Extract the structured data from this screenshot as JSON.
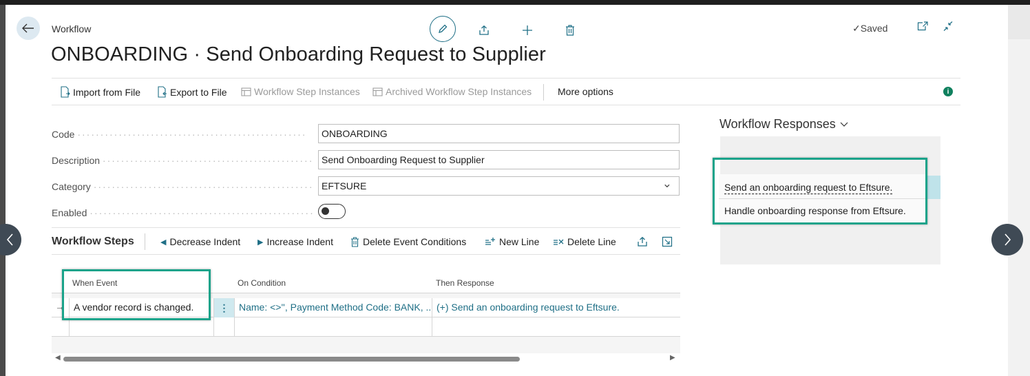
{
  "header": {
    "breadcrumb": "Workflow",
    "title": "ONBOARDING · Send Onboarding Request to Supplier",
    "saved": "Saved"
  },
  "actions": {
    "import": "Import from File",
    "export": "Export to File",
    "step_instances": "Workflow Step Instances",
    "archived_instances": "Archived Workflow Step Instances",
    "more": "More options"
  },
  "fields": {
    "code_label": "Code",
    "code_value": "ONBOARDING",
    "description_label": "Description",
    "description_value": "Send Onboarding Request to Supplier",
    "category_label": "Category",
    "category_value": "EFTSURE",
    "enabled_label": "Enabled",
    "enabled_value": false
  },
  "workflow_steps": {
    "title": "Workflow Steps",
    "decrease_indent": "Decrease Indent",
    "increase_indent": "Increase Indent",
    "delete_event_conditions": "Delete Event Conditions",
    "new_line": "New Line",
    "delete_line": "Delete Line",
    "columns": [
      "When Event",
      "On Condition",
      "Then Response"
    ],
    "rows": [
      {
        "when_event": "A vendor record is changed.",
        "on_condition": "Name: <>'', Payment Method Code: BANK, ...",
        "then_response": "(+) Send an onboarding request to Eftsure."
      }
    ]
  },
  "workflow_responses": {
    "title": "Workflow Responses",
    "items": [
      "Send an onboarding request to Eftsure.",
      "Handle onboarding response from Eftsure."
    ]
  },
  "colors": {
    "accent": "#1f6f86",
    "highlight": "#1aa38a"
  }
}
